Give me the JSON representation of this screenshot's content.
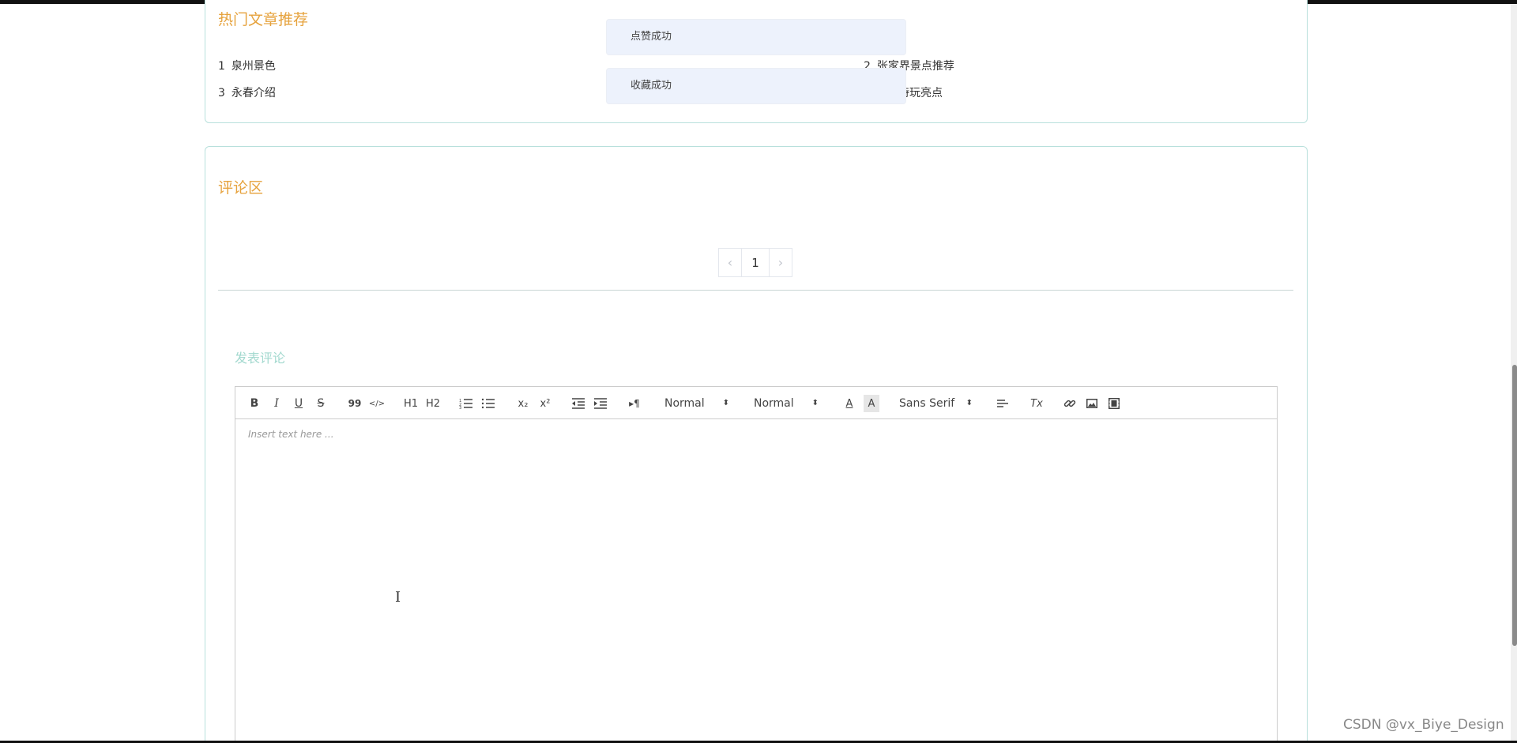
{
  "hot_articles": {
    "title": "热门文章推荐",
    "items": [
      {
        "num": "1",
        "label": "泉州景色"
      },
      {
        "num": "2",
        "label": "张家界景点推荐"
      },
      {
        "num": "3",
        "label": "永春介绍"
      },
      {
        "num": "",
        "label": "特玩亮点"
      }
    ]
  },
  "toasts": {
    "like": "点赞成功",
    "favorite": "收藏成功"
  },
  "comments": {
    "title": "评论区",
    "pagination": {
      "prev": "‹",
      "current": "1",
      "next": "›"
    },
    "post_title": "发表评论"
  },
  "editor": {
    "placeholder": "Insert text here ...",
    "toolbar": {
      "bold": "B",
      "italic": "I",
      "underline": "U",
      "strike": "S",
      "blockquote": "99",
      "code": "</>",
      "h1": "H1",
      "h2": "H2",
      "subscript": "x₂",
      "superscript": "x²",
      "direction": "▸¶",
      "size_select": "Normal",
      "header_select": "Normal",
      "text_color": "A",
      "bg_color": "A",
      "font_select": "Sans Serif",
      "clean": "Tx"
    }
  },
  "watermark": "CSDN @vx_Biye_Design"
}
